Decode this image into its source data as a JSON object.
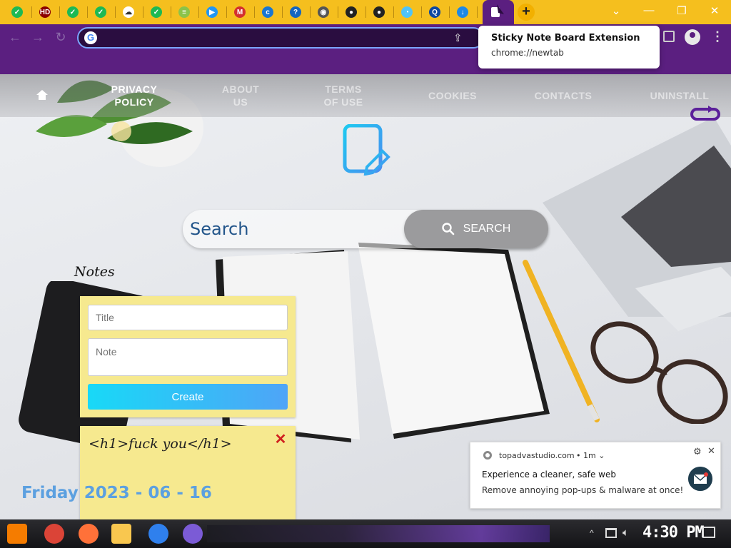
{
  "browser": {
    "tabs": [
      {
        "icon": "green-check-icon",
        "color": "#1db954"
      },
      {
        "icon": "hd-icon",
        "color": "#8b0000"
      },
      {
        "icon": "green-check-icon",
        "color": "#1db954"
      },
      {
        "icon": "green-check-icon",
        "color": "#1db954"
      },
      {
        "icon": "cloud-icon",
        "color": "#ffffff"
      },
      {
        "icon": "green-check-icon",
        "color": "#1db954"
      },
      {
        "icon": "document-icon",
        "color": "#8bc34a"
      },
      {
        "icon": "play-icon",
        "color": "#2196f3"
      },
      {
        "icon": "mcafee-shield-icon",
        "color": "#d32f2f"
      },
      {
        "icon": "c-icon",
        "color": "#1976d2"
      },
      {
        "icon": "question-icon",
        "color": "#1565c0"
      },
      {
        "icon": "globe-icon",
        "color": "#555555"
      },
      {
        "icon": "github-icon",
        "color": "#222222"
      },
      {
        "icon": "github-icon",
        "color": "#222222"
      },
      {
        "icon": "chart-icon",
        "color": "#4fc3f7"
      },
      {
        "icon": "q-icon",
        "color": "#0d47a1"
      },
      {
        "icon": "download-icon",
        "color": "#1e88e5"
      }
    ],
    "active_tab_icon": "sticky-note-icon",
    "new_tab_label": "+",
    "window_controls": {
      "dropdown": "⌄",
      "minimize": "—",
      "restore": "❐",
      "close": "✕"
    },
    "address_bar_value": "",
    "tooltip": {
      "title": "Sticky Note Board Extension",
      "url": "chrome://newtab"
    }
  },
  "page": {
    "nav": [
      {
        "label": "PRIVACY\nPOLICY",
        "dim": false
      },
      {
        "label": "ABOUT\nUS",
        "dim": true
      },
      {
        "label": "TERMS\nOF USE",
        "dim": true
      },
      {
        "label": "COOKIES",
        "dim": true
      },
      {
        "label": "CONTACTS",
        "dim": true
      },
      {
        "label": "UNINSTALL",
        "dim": true
      }
    ],
    "search": {
      "placeholder": "Search",
      "button_label": "SEARCH"
    },
    "notes_heading": "Notes",
    "form": {
      "title_placeholder": "Title",
      "note_placeholder": "Note",
      "create_label": "Create"
    },
    "sticky_note": {
      "text": "<h1>fuck you</h1>",
      "delete_label": "✕"
    },
    "date": "Friday 2023 - 06 - 16"
  },
  "notification": {
    "source": "topadvastudio.com",
    "time": "• 1m ⌄",
    "title": "Experience a cleaner, safe web",
    "body": "Remove annoying pop-ups & malware at once!"
  },
  "taskbar": {
    "apps": [
      {
        "icon": "start-icon",
        "color": "#f57c00"
      },
      {
        "icon": "chrome-icon",
        "color": "#db4437"
      },
      {
        "icon": "firefox-icon",
        "color": "#ff7139"
      },
      {
        "icon": "file-explorer-icon",
        "color": "#f9c74f"
      },
      {
        "icon": "internet-explorer-icon",
        "color": "#2f80ed"
      },
      {
        "icon": "visual-studio-icon",
        "color": "#7b5bd6"
      }
    ],
    "clock": "4:30 PM"
  }
}
